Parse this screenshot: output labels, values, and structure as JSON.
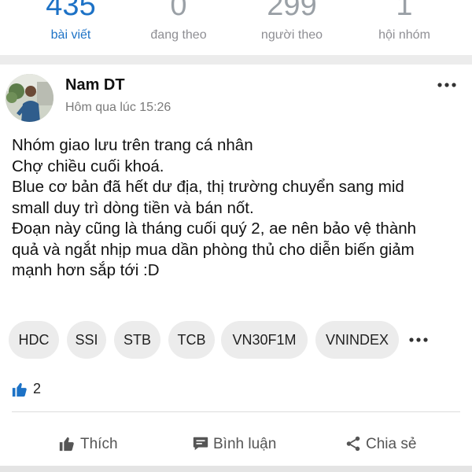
{
  "stats": [
    {
      "value": "435",
      "label": "bài viết"
    },
    {
      "value": "0",
      "label": "đang theo"
    },
    {
      "value": "299",
      "label": "người theo"
    },
    {
      "value": "1",
      "label": "hội nhóm"
    }
  ],
  "post": {
    "author": "Nam DT",
    "time": "Hôm qua lúc 15:26",
    "lines": [
      "Nhóm giao lưu trên trang cá nhân",
      "Chợ chiều cuối khoá.",
      "Blue cơ bản đã hết dư địa, thị trường chuyển sang mid",
      "small duy trì dòng tiền và bán nốt.",
      "Đoạn này cũng là tháng cuối quý 2, ae nên bảo vệ thành",
      "quả và ngắt nhịp mua dần phòng thủ cho diễn biến giảm",
      "mạnh hơn sắp tới :D"
    ],
    "tags": [
      "HDC",
      "SSI",
      "STB",
      "TCB",
      "VN30F1M",
      "VNINDEX"
    ],
    "likes": "2"
  },
  "actions": {
    "like": "Thích",
    "comment": "Bình luận",
    "share": "Chia sẻ"
  },
  "colors": {
    "accent": "#1d72c6",
    "muted": "#8e8e93",
    "tag_bg": "#ececec"
  }
}
